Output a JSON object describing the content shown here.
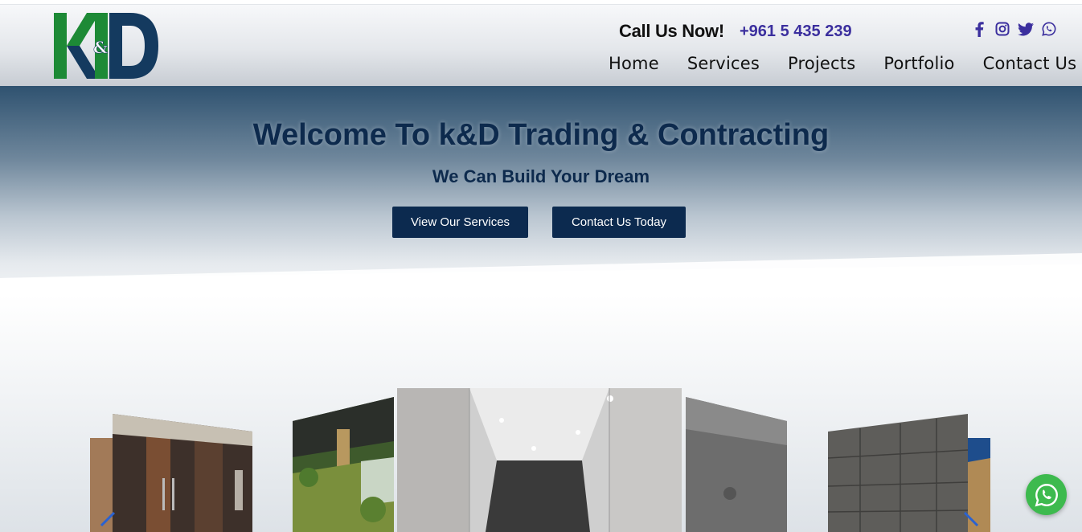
{
  "header": {
    "logo_text": "k&D",
    "call_label": "Call Us Now!",
    "phone": "+961 5 435 239",
    "social": [
      "facebook-icon",
      "instagram-icon",
      "twitter-icon",
      "whatsapp-icon"
    ],
    "social_color": "#3b2f9e"
  },
  "nav": {
    "items": [
      "Home",
      "Services",
      "Projects",
      "Portfolio",
      "Contact Us"
    ]
  },
  "hero": {
    "title": "Welcome To k&D Trading & Contracting",
    "subtitle": "We Can Build Your Dream",
    "primary_button": "View Our Services",
    "secondary_button": "Contact Us Today"
  },
  "gallery": {
    "slides": [
      "kitchen-cabinets",
      "pergola-garden",
      "bathroom-shower",
      "gray-panel",
      "stone-wall"
    ],
    "prev_icon": "chevron-left-icon",
    "next_icon": "chevron-right-icon"
  },
  "colors": {
    "brand_navy": "#0c2a4f",
    "brand_green": "#1f9a3a",
    "whatsapp_green": "#3dba4e"
  }
}
